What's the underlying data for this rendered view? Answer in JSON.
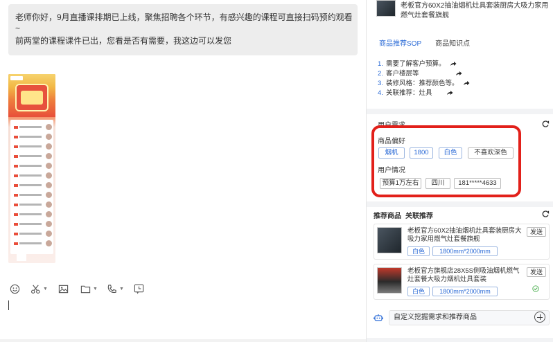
{
  "chat": {
    "message_line1": "老师你好，9月直播课排期已上线，聚焦招聘各个环节，有感兴趣的课程可直接扫码预约观看",
    "message_tilde": "~",
    "message_line2": "前两堂的课程课件已出，您看是否有需要，我这边可以发您",
    "toolbar_icons": [
      "emoji-icon",
      "scissors-icon",
      "image-icon",
      "folder-icon",
      "phone-icon",
      "chat-history-icon"
    ]
  },
  "panel": {
    "top_product_title": "老板官方60X2抽油烟机灶具套装厨房大吸力家用燃气灶套餐旗舰",
    "tabs": [
      "商品推荐SOP",
      "商品知识点"
    ],
    "steps": [
      {
        "num": "1.",
        "text": "需要了解客户预算。"
      },
      {
        "num": "2.",
        "text": "客户楼层等"
      },
      {
        "num": "3.",
        "text": "装修风格：推荐颜色等。"
      },
      {
        "num": "4.",
        "text": "关联推荐：灶具"
      }
    ],
    "user_needs": {
      "title": "用户需求",
      "pref_label": "商品偏好",
      "pref_tags": [
        "烟机",
        "1800",
        "白色",
        "不喜欢深色"
      ],
      "situation_label": "用户情况",
      "situation_tags": [
        "预算1万左右",
        "四川",
        "181*****4633"
      ]
    },
    "recommend": {
      "tab1": "推荐商品",
      "tab2": "关联推荐",
      "items": [
        {
          "title": "老板官方60X2抽油烟机灶具套装厨房大吸力家用燃气灶套餐旗舰",
          "tag1": "白色",
          "tag2": "1800mm*2000mm",
          "send": "发送"
        },
        {
          "title": "老板官方旗舰店28X5S侧吸油烟机燃气灶套餐大吸力烟机灶具套装",
          "tag1": "白色",
          "tag2": "1800mm*2000mm",
          "send": "发送"
        }
      ]
    },
    "custom_placeholder": "自定义挖掘需求和推荐商品"
  },
  "colors": {
    "accent_blue": "#2a6ad6",
    "highlight_red": "#e2201a",
    "bubble_gray": "#ededed"
  }
}
